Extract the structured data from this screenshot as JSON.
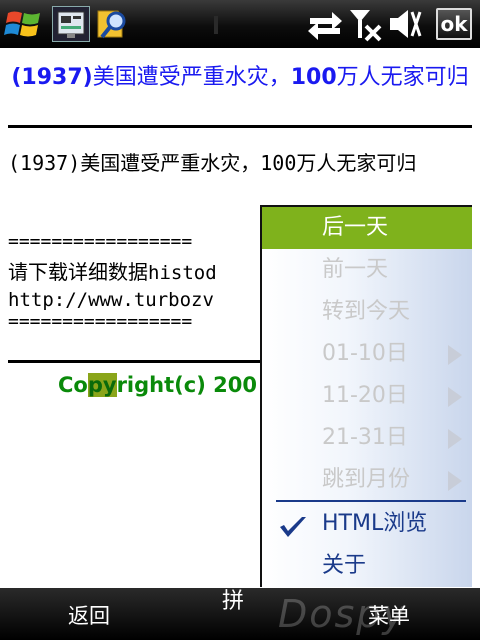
{
  "status_bar": {
    "ok_label": "ok",
    "icons": [
      "windows-start-icon",
      "app-icon",
      "search-app-icon",
      "sync-icon",
      "no-signal-icon",
      "volume-icon"
    ]
  },
  "article": {
    "title_year": "(1937)",
    "title_part1": "美国遭受严重水灾，",
    "title_number": "100",
    "title_part2": "万人无家可归",
    "body_year": "(1937)",
    "body_part1": "美国遭受严重水灾，",
    "body_number": "100",
    "body_part2": "万人无家可归",
    "separator": "=================",
    "download_text": "请下载详细数据",
    "download_suffix": "histod",
    "url_text": "http://www.turbozv",
    "copyright_a": "Co",
    "copyright_b": "py",
    "copyright_c": "right(c) 200"
  },
  "menu": {
    "items": [
      {
        "label": "后一天",
        "state": "highlighted"
      },
      {
        "label": "前一天",
        "state": "disabled"
      },
      {
        "label": "转到今天",
        "state": "disabled"
      },
      {
        "label": "01-10日",
        "state": "disabled",
        "submenu": true
      },
      {
        "label": "11-20日",
        "state": "disabled",
        "submenu": true
      },
      {
        "label": "21-31日",
        "state": "disabled",
        "submenu": true
      },
      {
        "label": "跳到月份",
        "state": "disabled",
        "submenu": true
      },
      {
        "label": "HTML浏览",
        "state": "checked"
      },
      {
        "label": "关于",
        "state": "enabled"
      }
    ]
  },
  "softkeys": {
    "left": "返回",
    "ime": "拼",
    "right": "菜单",
    "watermark": "Dospy"
  },
  "colors": {
    "title_blue": "#1a1af0",
    "copyright_green": "#0a8a0a",
    "menu_highlight": "#7fb21c",
    "menu_text": "#1a3a8a",
    "menu_disabled": "#c9c9c9"
  }
}
